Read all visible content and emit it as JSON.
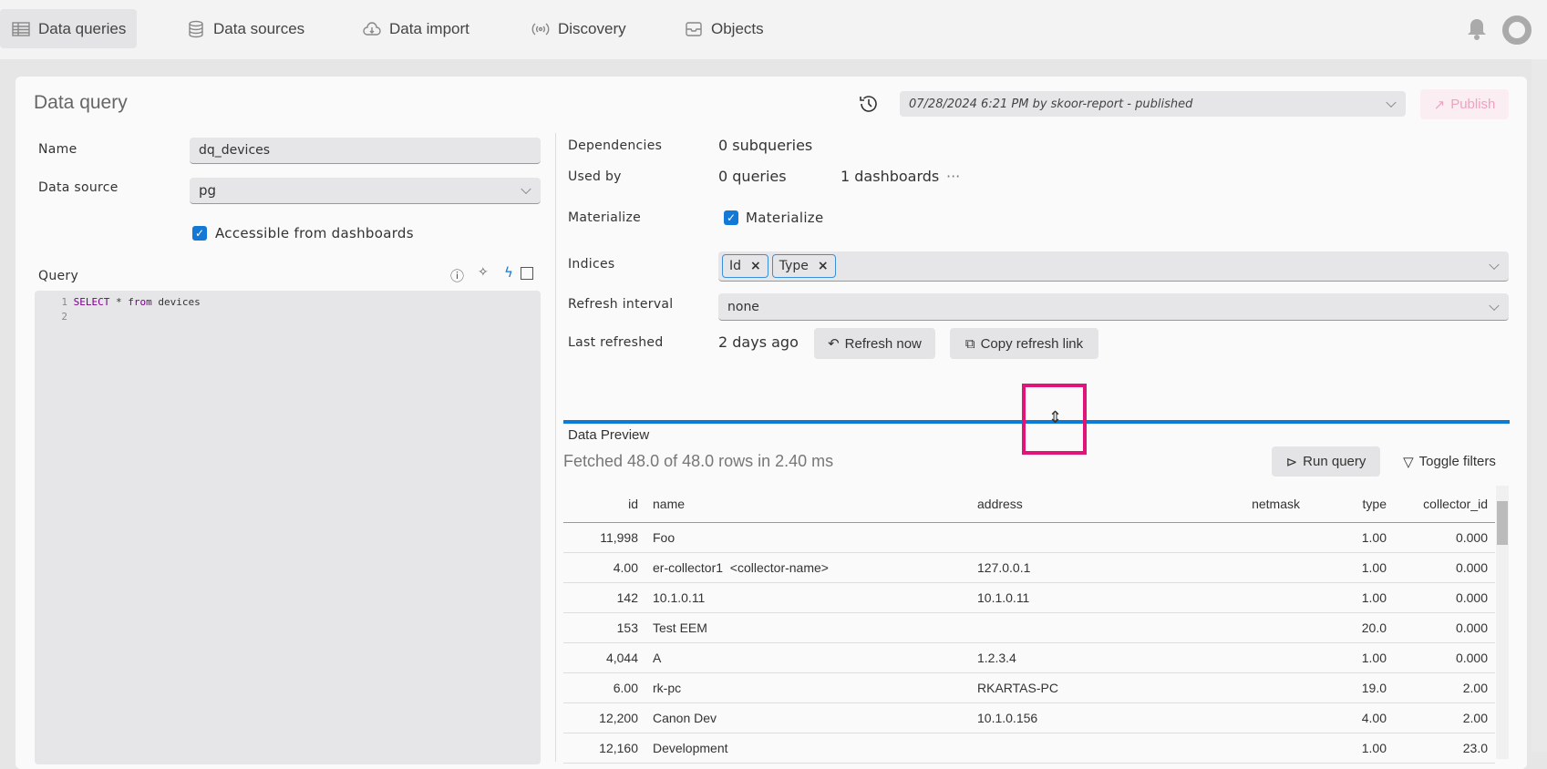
{
  "nav": {
    "tabs": [
      {
        "label": "Data queries",
        "icon": "table-icon",
        "active": true
      },
      {
        "label": "Data sources",
        "icon": "database-icon"
      },
      {
        "label": "Data import",
        "icon": "cloud-download-icon"
      },
      {
        "label": "Discovery",
        "icon": "broadcast-icon"
      },
      {
        "label": "Objects",
        "icon": "inbox-icon"
      }
    ]
  },
  "header": {
    "title": "Data query",
    "version": "07/28/2024 6:21 PM by skoor-report - published",
    "publish_label": "Publish"
  },
  "left": {
    "name_label": "Name",
    "name_value": "dq_devices",
    "source_label": "Data source",
    "source_value": "pg",
    "accessible_label": "Accessible from dashboards",
    "accessible_checked": true,
    "query_label": "Query",
    "code": [
      {
        "n": "1",
        "kw": "SELECT",
        "rest": " * ",
        "kw2": "from",
        "tail": " devices"
      },
      {
        "n": "2"
      }
    ]
  },
  "right": {
    "dependencies_label": "Dependencies",
    "dependencies_value": "0 subqueries",
    "usedby_label": "Used by",
    "usedby_queries": "0 queries",
    "usedby_dashboards": "1 dashboards",
    "more": "···",
    "materialize_label": "Materialize",
    "materialize_check_label": "Materialize",
    "materialize_checked": true,
    "indices_label": "Indices",
    "indices": [
      "Id",
      "Type"
    ],
    "interval_label": "Refresh interval",
    "interval_value": "none",
    "last_label": "Last refreshed",
    "last_value": "2 days ago",
    "refresh_now": "Refresh now",
    "copy_link": "Copy refresh link"
  },
  "preview": {
    "title": "Data Preview",
    "status": "Fetched 48.0 of 48.0 rows in 2.40 ms",
    "run_query": "Run query",
    "toggle_filters": "Toggle filters",
    "columns": [
      "id",
      "name",
      "address",
      "netmask",
      "type",
      "collector_id"
    ],
    "rows": [
      [
        "11,998",
        "Foo",
        "",
        "",
        "1.00",
        "0.000"
      ],
      [
        "4.00",
        "er-collector1  <collector-name>",
        "127.0.0.1",
        "",
        "1.00",
        "0.000"
      ],
      [
        "142",
        "10.1.0.11",
        "10.1.0.11",
        "",
        "1.00",
        "0.000"
      ],
      [
        "153",
        "Test EEM",
        "",
        "",
        "20.0",
        "0.000"
      ],
      [
        "4,044",
        "A",
        "1.2.3.4",
        "",
        "1.00",
        "0.000"
      ],
      [
        "6.00",
        "rk-pc",
        "RKARTAS-PC",
        "",
        "19.0",
        "2.00"
      ],
      [
        "12,200",
        "Canon Dev",
        "10.1.0.156",
        "",
        "4.00",
        "2.00"
      ],
      [
        "12,160",
        "Development",
        "",
        "",
        "1.00",
        "23.0"
      ]
    ]
  },
  "colors": {
    "accent": "#0a7bd6",
    "highlight": "#e0157a"
  }
}
